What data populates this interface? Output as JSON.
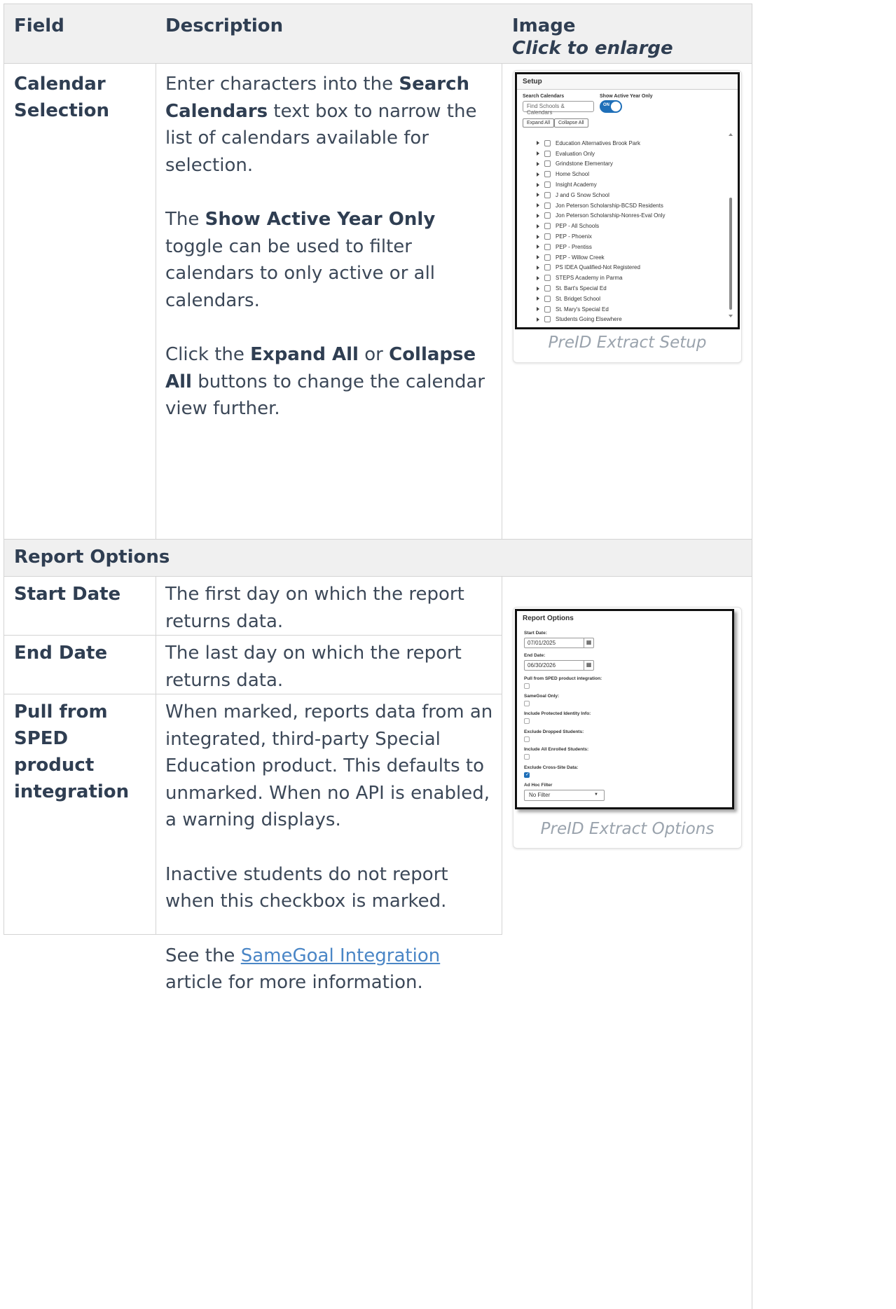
{
  "table": {
    "headers": {
      "field": "Field",
      "description": "Description",
      "image": "Image",
      "image_sub": "Click to enlarge"
    },
    "calendar_row": {
      "field": "Calendar Selection",
      "p1_pre": "Enter characters into the ",
      "p1_bold": "Search Calendars",
      "p1_post": " text box to narrow the list of calendars available for selection.",
      "p2_pre": "The ",
      "p2_bold": "Show Active Year Only",
      "p2_post": " toggle can be used to filter calendars to only active or all calendars.",
      "p3_pre": "Click the ",
      "p3_bold1": "Expand All",
      "p3_mid": " or ",
      "p3_bold2": "Collapse All",
      "p3_post": " buttons to change the calendar view further.",
      "caption": "PreID Extract Setup"
    },
    "section_header": "Report Options",
    "rows": [
      {
        "field": "Start Date",
        "description": "The first day on which the report returns data."
      },
      {
        "field": "End Date",
        "description": "The last day on which the report returns data."
      }
    ],
    "sped_row": {
      "field": "Pull from SPED product integration",
      "p1": "When marked, reports data from an integrated, third-party Special Education product. This defaults to unmarked. When no API is enabled, a warning displays.",
      "p2": "Inactive students do not report when this checkbox is marked.",
      "p3_pre": "See the ",
      "p3_link": "SameGoal Integration",
      "p3_post": " article for more information."
    },
    "options_caption": "PreID Extract Options"
  },
  "setup_screenshot": {
    "title": "Setup",
    "search_label": "Search Calendars",
    "search_placeholder": "Find Schools & Calendars",
    "toggle_label": "Show Active Year Only",
    "toggle_state": "ON",
    "expand_all": "Expand All",
    "collapse_all": "Collapse All",
    "calendars": [
      "Education Alternatives Brook Park",
      "Evaluation Only",
      "Grindstone Elementary",
      "Home School",
      "Insight Academy",
      "J and G Snow School",
      "Jon Peterson Scholarship-BCSD Residents",
      "Jon Peterson Scholarship-Nonres-Eval Only",
      "PEP - All Schools",
      "PEP - Phoenix",
      "PEP - Prentiss",
      "PEP - Willow Creek",
      "PS IDEA Qualified-Not Registered",
      "STEPS Academy in Parma",
      "St. Bart's Special Ed",
      "St. Bridget School",
      "St. Mary's Special Ed",
      "Students Going Elsewhere"
    ]
  },
  "options_screenshot": {
    "title": "Report Options",
    "start_label": "Start Date:",
    "start_value": "07/01/2025",
    "end_label": "End Date:",
    "end_value": "06/30/2026",
    "pull_label": "Pull from SPED product integration:",
    "samegoal_label": "SameGoal Only:",
    "protected_label": "Include Protected Identity Info:",
    "dropped_label": "Exclude Dropped Students:",
    "enrolled_label": "Include All Enrolled Students:",
    "crosssite_label": "Exclude Cross-Site Data:",
    "adhoc_label": "Ad Hoc Filter",
    "adhoc_value": "No Filter"
  }
}
